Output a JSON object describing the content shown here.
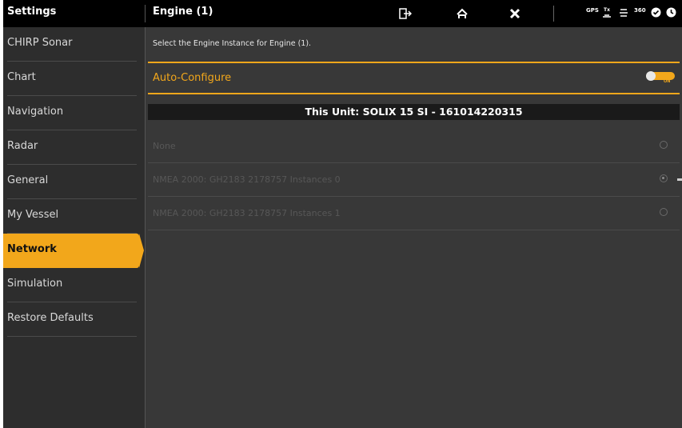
{
  "topbar": {
    "settings_label": "Settings",
    "page_title": "Engine (1)",
    "status": {
      "gps": "GPS",
      "tx": "Tx",
      "n360": "360"
    }
  },
  "sidebar": {
    "items": [
      {
        "label": "CHIRP Sonar",
        "active": false
      },
      {
        "label": "Chart",
        "active": false
      },
      {
        "label": "Navigation",
        "active": false
      },
      {
        "label": "Radar",
        "active": false
      },
      {
        "label": "General",
        "active": false
      },
      {
        "label": "My Vessel",
        "active": false
      },
      {
        "label": "Network",
        "active": true
      },
      {
        "label": "Simulation",
        "active": false
      },
      {
        "label": "Restore Defaults",
        "active": false
      }
    ]
  },
  "main": {
    "instruction": "Select the Engine Instance for Engine (1).",
    "auto_configure": {
      "label": "Auto-Configure",
      "state": "ON"
    },
    "unit_header": "This Unit: SOLIX 15 SI - 161014220315",
    "options": [
      {
        "label": "None",
        "selected": false
      },
      {
        "label": "NMEA 2000: GH2183 2178757  Instances 0",
        "selected": true
      },
      {
        "label": "NMEA 2000: GH2183 2178757  Instances 1",
        "selected": false
      }
    ]
  },
  "colors": {
    "accent": "#f2a71b",
    "background": "#383838",
    "sidebar": "#2d2d2d"
  }
}
